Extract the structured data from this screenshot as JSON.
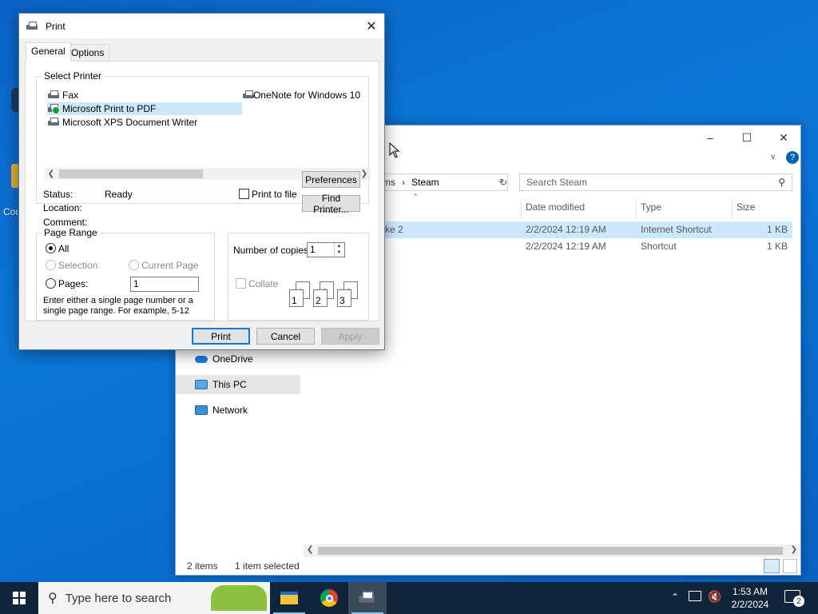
{
  "desktop": {
    "icons": [
      {
        "label": "Cou"
      }
    ]
  },
  "explorer": {
    "breadcrumb": {
      "prefix": "ms",
      "current": "Steam"
    },
    "search_placeholder": "Search Steam",
    "columns": {
      "date": "Date modified",
      "type": "Type",
      "size": "Size"
    },
    "files": [
      {
        "name": "ke 2",
        "date": "2/2/2024 12:19 AM",
        "type": "Internet Shortcut",
        "size": "1 KB"
      },
      {
        "name": "",
        "date": "2/2/2024 12:19 AM",
        "type": "Shortcut",
        "size": "1 KB"
      }
    ],
    "nav": [
      {
        "label": "OneDrive"
      },
      {
        "label": "This PC"
      },
      {
        "label": "Network"
      }
    ],
    "status": {
      "count": "2 items",
      "selected": "1 item selected"
    }
  },
  "dialog": {
    "title": "Print",
    "tabs": [
      "General",
      "Options"
    ],
    "select_printer_label": "Select Printer",
    "printers": [
      {
        "name": "Fax"
      },
      {
        "name": "Microsoft Print to PDF"
      },
      {
        "name": "Microsoft XPS Document Writer"
      },
      {
        "name": "OneNote for Windows 10"
      }
    ],
    "status_label": "Status:",
    "status_value": "Ready",
    "location_label": "Location:",
    "comment_label": "Comment:",
    "print_to_file": "Print to file",
    "preferences": "Preferences",
    "find_printer": "Find Printer...",
    "page_range": {
      "label": "Page Range",
      "all": "All",
      "selection": "Selection",
      "current_page": "Current Page",
      "pages": "Pages:",
      "pages_value": "1",
      "hint": "Enter either a single page number or a single page range.  For example, 5-12"
    },
    "copies": {
      "label": "Number of copies:",
      "value": "1",
      "collate": "Collate"
    },
    "buttons": {
      "print": "Print",
      "cancel": "Cancel",
      "apply": "Apply"
    }
  },
  "taskbar": {
    "search_placeholder": "Type here to search",
    "time": "1:53 AM",
    "date": "2/2/2024",
    "notifications": "2"
  }
}
